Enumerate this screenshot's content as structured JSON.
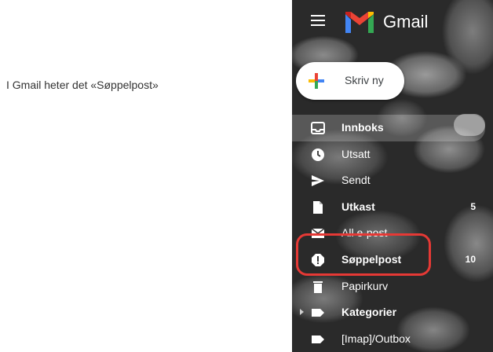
{
  "caption": "I Gmail heter det «Søppelpost»",
  "header": {
    "menu_icon": "hamburger-menu-icon",
    "logo_icon": "gmail-m-logo-icon",
    "logo_text": "Gmail"
  },
  "compose": {
    "label": "Skriv ny",
    "icon": "plus-icon"
  },
  "nav": {
    "items": [
      {
        "label": "Innboks",
        "icon": "inbox-icon",
        "bold": true,
        "count": ""
      },
      {
        "label": "Utsatt",
        "icon": "clock-icon",
        "bold": false,
        "count": ""
      },
      {
        "label": "Sendt",
        "icon": "send-icon",
        "bold": false,
        "count": ""
      },
      {
        "label": "Utkast",
        "icon": "draft-icon",
        "bold": true,
        "count": "5"
      },
      {
        "label": "All e-post",
        "icon": "all-mail-icon",
        "bold": false,
        "count": ""
      },
      {
        "label": "Søppelpost",
        "icon": "spam-icon",
        "bold": true,
        "count": "10"
      },
      {
        "label": "Papirkurv",
        "icon": "trash-icon",
        "bold": false,
        "count": ""
      },
      {
        "label": "Kategorier",
        "icon": "label-icon",
        "bold": true,
        "count": ""
      },
      {
        "label": "[Imap]/Outbox",
        "icon": "label-icon",
        "bold": false,
        "count": ""
      }
    ]
  },
  "colors": {
    "highlight": "#e53935",
    "gmail_red": "#ea4335",
    "gmail_blue": "#4285f4",
    "gmail_green": "#34a853",
    "gmail_yellow": "#fbbc04"
  }
}
